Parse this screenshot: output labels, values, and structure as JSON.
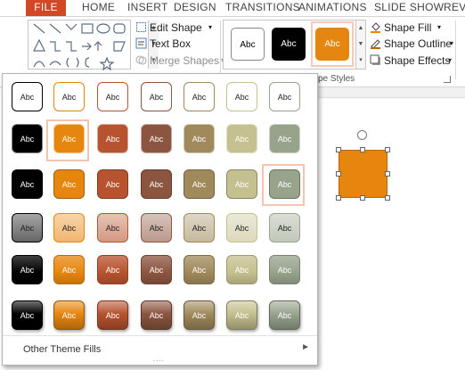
{
  "tabs": [
    "FILE",
    "HOME",
    "INSERT",
    "DESIGN",
    "TRANSITIONS",
    "ANIMATIONS",
    "SLIDE SHOW",
    "REVI"
  ],
  "ribbon": {
    "edit_shape": "Edit Shape",
    "text_box": "Text Box",
    "merge_shapes": "Merge Shapes",
    "shape_fill": "Shape Fill",
    "shape_outline": "Shape Outline",
    "shape_effects": "Shape Effects",
    "group_label": "pe Styles",
    "style_samples": [
      {
        "label": "Abc",
        "fill": "#ffffff",
        "text": "#222222"
      },
      {
        "label": "Abc",
        "fill": "#000000",
        "text": "#ffffff"
      },
      {
        "label": "Abc",
        "fill": "#e7860f",
        "text": "#ffffff"
      }
    ]
  },
  "gallery": {
    "tile_label": "Abc",
    "footer_label": "Other Theme Fills",
    "footer_grip": "....",
    "colors": [
      "#000000",
      "#e7860f",
      "#b7532f",
      "#8c5540",
      "#a08a5c",
      "#c5c08f",
      "#98a38c"
    ],
    "rows": [
      {
        "variant": "outline"
      },
      {
        "variant": "solid"
      },
      {
        "variant": "solid-dark"
      },
      {
        "variant": "light"
      },
      {
        "variant": "gradient"
      },
      {
        "variant": "gloss"
      }
    ]
  },
  "colors": {
    "file_tab": "#d24726",
    "selection_highlight": "#f5c4b0",
    "shape_fill": "#e7860f"
  }
}
